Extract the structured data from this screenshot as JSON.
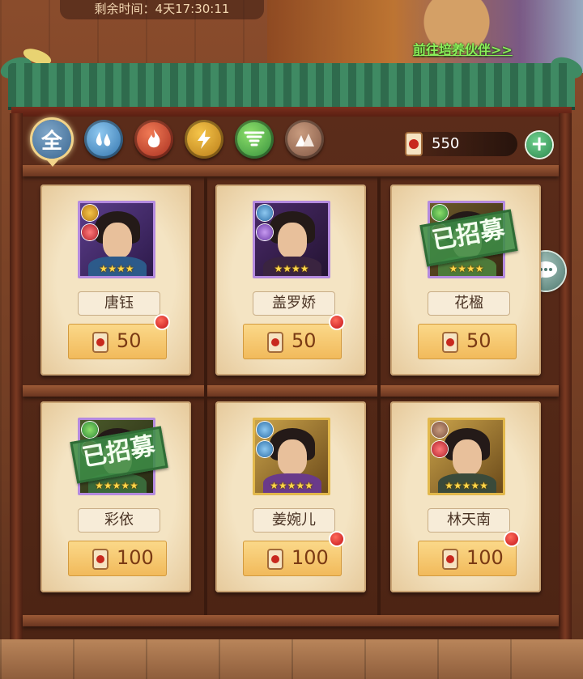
{
  "timer": {
    "label": "剩余时间：4天17:30:11"
  },
  "header": {
    "goto_partner_link": "前往培养伙伴>>"
  },
  "filters": [
    {
      "key": "all",
      "label": "全",
      "icon": "all-icon",
      "selected": true
    },
    {
      "key": "water",
      "icon": "water-drop-icon"
    },
    {
      "key": "fire",
      "icon": "fire-icon"
    },
    {
      "key": "thunder",
      "icon": "lightning-icon"
    },
    {
      "key": "wind",
      "icon": "tornado-icon"
    },
    {
      "key": "earth",
      "icon": "rocks-icon"
    }
  ],
  "currency": {
    "icon": "recruit-scroll-icon",
    "amount": "550",
    "add_icon": "plus-icon"
  },
  "cards": [
    {
      "name": "唐钰",
      "price": "50",
      "stars": "★★★★",
      "recruited": false,
      "red_dot": true,
      "elements": [
        "thunder",
        "red"
      ]
    },
    {
      "name": "盖罗娇",
      "price": "50",
      "stars": "★★★★",
      "recruited": false,
      "red_dot": true,
      "elements": [
        "water",
        "purple"
      ]
    },
    {
      "name": "花楹",
      "price": "50",
      "stars": "★★★★",
      "recruited": true,
      "red_dot": false,
      "elements": [
        "wind",
        "red"
      ]
    },
    {
      "name": "彩依",
      "price": "100",
      "stars": "★★★★★",
      "recruited": true,
      "red_dot": false,
      "elements": [
        "wind",
        "red"
      ]
    },
    {
      "name": "姜婉儿",
      "price": "100",
      "stars": "★★★★★",
      "recruited": false,
      "red_dot": true,
      "elements": [
        "water",
        "water"
      ]
    },
    {
      "name": "林天南",
      "price": "100",
      "stars": "★★★★★",
      "recruited": false,
      "red_dot": true,
      "elements": [
        "earth",
        "red"
      ]
    }
  ],
  "stamp_label": "已招募",
  "chat_button": {
    "icon": "chat-bubble-icon"
  }
}
